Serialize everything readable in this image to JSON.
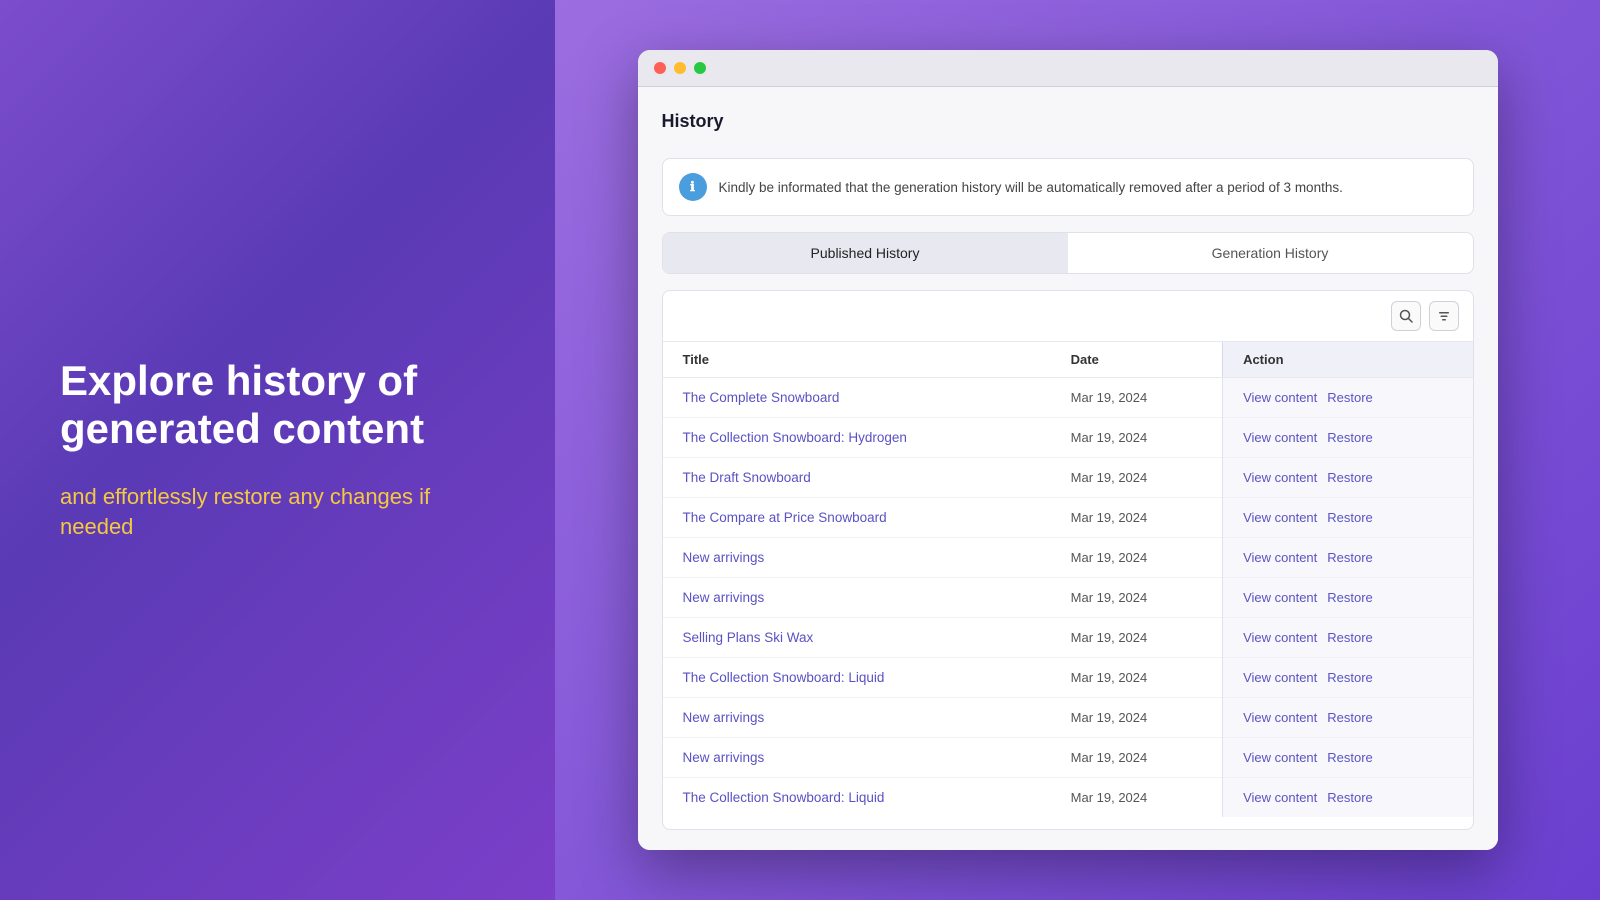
{
  "left": {
    "title": "Explore history of generated content",
    "subtitle": "and effortlessly restore any changes if needed"
  },
  "window": {
    "title": "History",
    "info_banner": "Kindly be informated that the generation history will be automatically removed after a period of 3 months.",
    "tabs": [
      {
        "label": "Published History",
        "active": true
      },
      {
        "label": "Generation History",
        "active": false
      }
    ],
    "toolbar": {
      "search_icon": "🔍",
      "filter_icon": "▤"
    },
    "table": {
      "columns": [
        "Title",
        "Date",
        "Action"
      ],
      "rows": [
        {
          "title": "The Complete Snowboard",
          "date": "Mar 19, 2024",
          "view": "View content",
          "restore": "Restore"
        },
        {
          "title": "The Collection Snowboard: Hydrogen",
          "date": "Mar 19, 2024",
          "view": "View content",
          "restore": "Restore"
        },
        {
          "title": "The Draft Snowboard",
          "date": "Mar 19, 2024",
          "view": "View content",
          "restore": "Restore"
        },
        {
          "title": "The Compare at Price Snowboard",
          "date": "Mar 19, 2024",
          "view": "View content",
          "restore": "Restore"
        },
        {
          "title": "New arrivings",
          "date": "Mar 19, 2024",
          "view": "View content",
          "restore": "Restore"
        },
        {
          "title": "New arrivings",
          "date": "Mar 19, 2024",
          "view": "View content",
          "restore": "Restore"
        },
        {
          "title": "Selling Plans Ski Wax",
          "date": "Mar 19, 2024",
          "view": "View content",
          "restore": "Restore"
        },
        {
          "title": "The Collection Snowboard: Liquid",
          "date": "Mar 19, 2024",
          "view": "View content",
          "restore": "Restore"
        },
        {
          "title": "New arrivings",
          "date": "Mar 19, 2024",
          "view": "View content",
          "restore": "Restore"
        },
        {
          "title": "New arrivings",
          "date": "Mar 19, 2024",
          "view": "View content",
          "restore": "Restore"
        },
        {
          "title": "The Collection Snowboard: Liquid",
          "date": "Mar 19, 2024",
          "view": "View content",
          "restore": "Restore"
        }
      ]
    }
  }
}
